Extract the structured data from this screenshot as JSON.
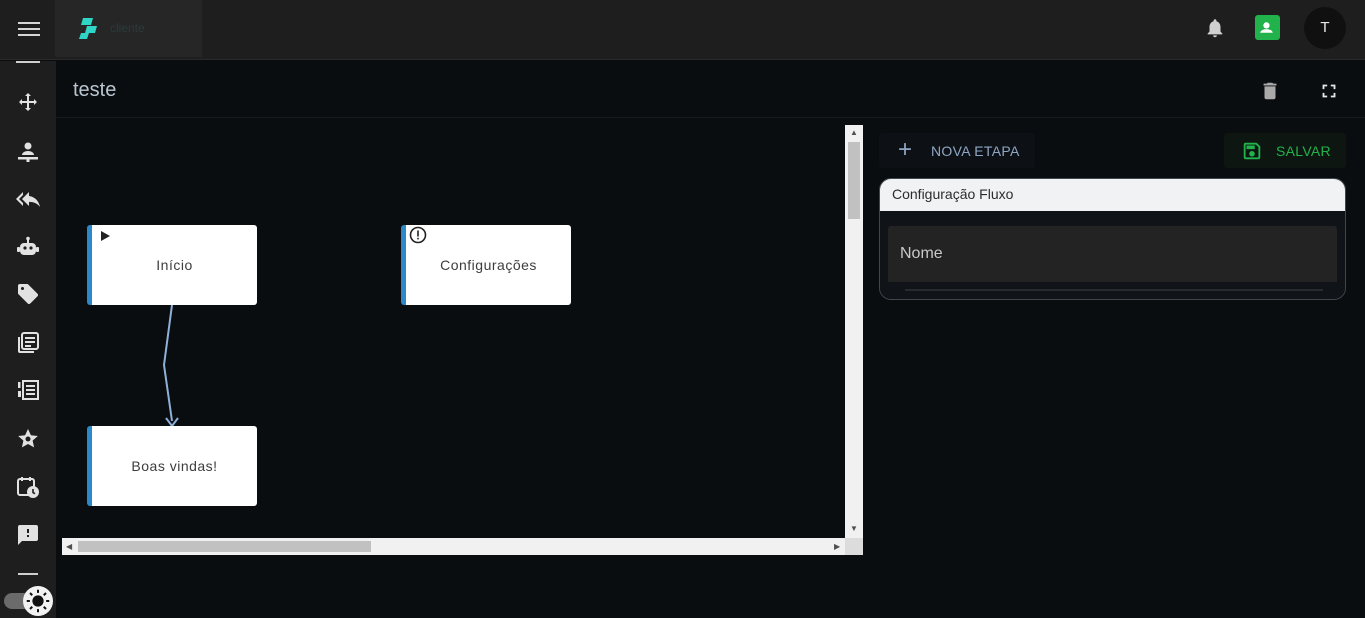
{
  "app": {
    "logo_text": "cliente",
    "avatar_initial": "T"
  },
  "sidebar": {
    "items": [
      {
        "icon": "move-arrows-icon"
      },
      {
        "icon": "person-pin-icon"
      },
      {
        "icon": "reply-all-icon"
      },
      {
        "icon": "robot-icon"
      },
      {
        "icon": "tag-icon"
      },
      {
        "icon": "library-books-icon"
      },
      {
        "icon": "list-numbered-icon"
      },
      {
        "icon": "star-rate-icon"
      },
      {
        "icon": "calendar-clock-icon"
      },
      {
        "icon": "feedback-icon"
      }
    ]
  },
  "page": {
    "title": "teste"
  },
  "flow": {
    "nodes": [
      {
        "label": "Início",
        "icon": "play-icon"
      },
      {
        "label": "Configurações",
        "icon": "error-icon"
      },
      {
        "label": "Boas vindas!",
        "icon": ""
      }
    ]
  },
  "toolbar": {
    "new_step_label": "NOVA ETAPA",
    "save_label": "SALVAR"
  },
  "config": {
    "title": "Configuração Fluxo",
    "name_placeholder": "Nome"
  },
  "colors": {
    "accent_blue": "#2c89c9",
    "save_green": "#22b24c",
    "edge_color": "#8fb0db"
  }
}
